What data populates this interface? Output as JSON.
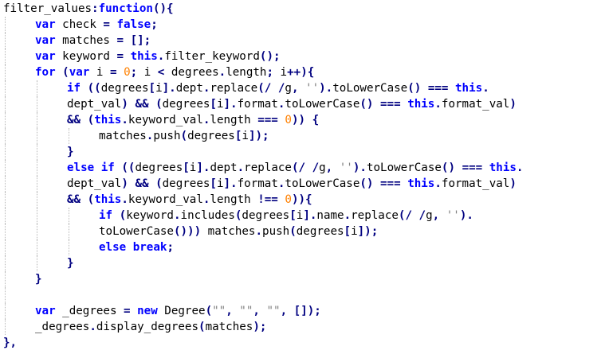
{
  "colors": {
    "background": "#ffffff",
    "plain_text": "#000000",
    "keyword": "#0000ff",
    "operator": "#000080",
    "number": "#ff8000",
    "string": "#808080",
    "indent_guide": "#b9b9b9"
  },
  "code": {
    "lines": [
      {
        "indent": 0,
        "tokens": [
          {
            "t": "plain",
            "v": "filter_values"
          },
          {
            "t": "op",
            "v": ":"
          },
          {
            "t": "kw",
            "v": "function"
          },
          {
            "t": "op",
            "v": "(){"
          }
        ]
      },
      {
        "indent": 1,
        "tokens": [
          {
            "t": "kw",
            "v": "var"
          },
          {
            "t": "plain",
            "v": " check "
          },
          {
            "t": "op",
            "v": "="
          },
          {
            "t": "plain",
            "v": " "
          },
          {
            "t": "kw",
            "v": "false"
          },
          {
            "t": "op",
            "v": ";"
          }
        ]
      },
      {
        "indent": 1,
        "tokens": [
          {
            "t": "kw",
            "v": "var"
          },
          {
            "t": "plain",
            "v": " matches "
          },
          {
            "t": "op",
            "v": "="
          },
          {
            "t": "plain",
            "v": " "
          },
          {
            "t": "op",
            "v": "[];"
          }
        ]
      },
      {
        "indent": 1,
        "tokens": [
          {
            "t": "kw",
            "v": "var"
          },
          {
            "t": "plain",
            "v": " keyword "
          },
          {
            "t": "op",
            "v": "="
          },
          {
            "t": "plain",
            "v": " "
          },
          {
            "t": "kw",
            "v": "this"
          },
          {
            "t": "op",
            "v": "."
          },
          {
            "t": "plain",
            "v": "filter_keyword"
          },
          {
            "t": "op",
            "v": "();"
          }
        ]
      },
      {
        "indent": 1,
        "tokens": [
          {
            "t": "kw",
            "v": "for"
          },
          {
            "t": "plain",
            "v": " "
          },
          {
            "t": "op",
            "v": "("
          },
          {
            "t": "kw",
            "v": "var"
          },
          {
            "t": "plain",
            "v": " i "
          },
          {
            "t": "op",
            "v": "="
          },
          {
            "t": "plain",
            "v": " "
          },
          {
            "t": "num",
            "v": "0"
          },
          {
            "t": "op",
            "v": ";"
          },
          {
            "t": "plain",
            "v": " i "
          },
          {
            "t": "op",
            "v": "<"
          },
          {
            "t": "plain",
            "v": " degrees"
          },
          {
            "t": "op",
            "v": "."
          },
          {
            "t": "plain",
            "v": "length"
          },
          {
            "t": "op",
            "v": ";"
          },
          {
            "t": "plain",
            "v": " i"
          },
          {
            "t": "op",
            "v": "++){"
          }
        ]
      },
      {
        "indent": 2,
        "tokens": [
          {
            "t": "kw",
            "v": "if"
          },
          {
            "t": "plain",
            "v": " "
          },
          {
            "t": "op",
            "v": "(("
          },
          {
            "t": "plain",
            "v": "degrees"
          },
          {
            "t": "op",
            "v": "["
          },
          {
            "t": "plain",
            "v": "i"
          },
          {
            "t": "op",
            "v": "]."
          },
          {
            "t": "plain",
            "v": "dept"
          },
          {
            "t": "op",
            "v": "."
          },
          {
            "t": "plain",
            "v": "replace"
          },
          {
            "t": "op",
            "v": "(/ /"
          },
          {
            "t": "plain",
            "v": "g"
          },
          {
            "t": "op",
            "v": ","
          },
          {
            "t": "plain",
            "v": " "
          },
          {
            "t": "str",
            "v": "''"
          },
          {
            "t": "op",
            "v": ")."
          },
          {
            "t": "plain",
            "v": "toLowerCase"
          },
          {
            "t": "op",
            "v": "()"
          },
          {
            "t": "plain",
            "v": " "
          },
          {
            "t": "op",
            "v": "==="
          },
          {
            "t": "plain",
            "v": " "
          },
          {
            "t": "kw",
            "v": "this"
          },
          {
            "t": "op",
            "v": "."
          }
        ]
      },
      {
        "indent": 2,
        "tokens": [
          {
            "t": "plain",
            "v": "dept_val"
          },
          {
            "t": "op",
            "v": ")"
          },
          {
            "t": "plain",
            "v": " "
          },
          {
            "t": "op",
            "v": "&&"
          },
          {
            "t": "plain",
            "v": " "
          },
          {
            "t": "op",
            "v": "("
          },
          {
            "t": "plain",
            "v": "degrees"
          },
          {
            "t": "op",
            "v": "["
          },
          {
            "t": "plain",
            "v": "i"
          },
          {
            "t": "op",
            "v": "]."
          },
          {
            "t": "plain",
            "v": "format"
          },
          {
            "t": "op",
            "v": "."
          },
          {
            "t": "plain",
            "v": "toLowerCase"
          },
          {
            "t": "op",
            "v": "()"
          },
          {
            "t": "plain",
            "v": " "
          },
          {
            "t": "op",
            "v": "==="
          },
          {
            "t": "plain",
            "v": " "
          },
          {
            "t": "kw",
            "v": "this"
          },
          {
            "t": "op",
            "v": "."
          },
          {
            "t": "plain",
            "v": "format_val"
          },
          {
            "t": "op",
            "v": ")"
          }
        ]
      },
      {
        "indent": 2,
        "tokens": [
          {
            "t": "op",
            "v": "&&"
          },
          {
            "t": "plain",
            "v": " "
          },
          {
            "t": "op",
            "v": "("
          },
          {
            "t": "kw",
            "v": "this"
          },
          {
            "t": "op",
            "v": "."
          },
          {
            "t": "plain",
            "v": "keyword_val"
          },
          {
            "t": "op",
            "v": "."
          },
          {
            "t": "plain",
            "v": "length "
          },
          {
            "t": "op",
            "v": "==="
          },
          {
            "t": "plain",
            "v": " "
          },
          {
            "t": "num",
            "v": "0"
          },
          {
            "t": "op",
            "v": "))"
          },
          {
            "t": "plain",
            "v": " "
          },
          {
            "t": "op",
            "v": "{"
          }
        ]
      },
      {
        "indent": 3,
        "tokens": [
          {
            "t": "plain",
            "v": "matches"
          },
          {
            "t": "op",
            "v": "."
          },
          {
            "t": "plain",
            "v": "push"
          },
          {
            "t": "op",
            "v": "("
          },
          {
            "t": "plain",
            "v": "degrees"
          },
          {
            "t": "op",
            "v": "["
          },
          {
            "t": "plain",
            "v": "i"
          },
          {
            "t": "op",
            "v": "]);"
          }
        ]
      },
      {
        "indent": 2,
        "tokens": [
          {
            "t": "op",
            "v": "}"
          }
        ]
      },
      {
        "indent": 2,
        "tokens": [
          {
            "t": "kw",
            "v": "else"
          },
          {
            "t": "plain",
            "v": " "
          },
          {
            "t": "kw",
            "v": "if"
          },
          {
            "t": "plain",
            "v": " "
          },
          {
            "t": "op",
            "v": "(("
          },
          {
            "t": "plain",
            "v": "degrees"
          },
          {
            "t": "op",
            "v": "["
          },
          {
            "t": "plain",
            "v": "i"
          },
          {
            "t": "op",
            "v": "]."
          },
          {
            "t": "plain",
            "v": "dept"
          },
          {
            "t": "op",
            "v": "."
          },
          {
            "t": "plain",
            "v": "replace"
          },
          {
            "t": "op",
            "v": "(/ /"
          },
          {
            "t": "plain",
            "v": "g"
          },
          {
            "t": "op",
            "v": ","
          },
          {
            "t": "plain",
            "v": " "
          },
          {
            "t": "str",
            "v": "''"
          },
          {
            "t": "op",
            "v": ")."
          },
          {
            "t": "plain",
            "v": "toLowerCase"
          },
          {
            "t": "op",
            "v": "()"
          },
          {
            "t": "plain",
            "v": " "
          },
          {
            "t": "op",
            "v": "==="
          },
          {
            "t": "plain",
            "v": " "
          },
          {
            "t": "kw",
            "v": "this"
          },
          {
            "t": "op",
            "v": "."
          }
        ]
      },
      {
        "indent": 2,
        "tokens": [
          {
            "t": "plain",
            "v": "dept_val"
          },
          {
            "t": "op",
            "v": ")"
          },
          {
            "t": "plain",
            "v": " "
          },
          {
            "t": "op",
            "v": "&&"
          },
          {
            "t": "plain",
            "v": " "
          },
          {
            "t": "op",
            "v": "("
          },
          {
            "t": "plain",
            "v": "degrees"
          },
          {
            "t": "op",
            "v": "["
          },
          {
            "t": "plain",
            "v": "i"
          },
          {
            "t": "op",
            "v": "]."
          },
          {
            "t": "plain",
            "v": "format"
          },
          {
            "t": "op",
            "v": "."
          },
          {
            "t": "plain",
            "v": "toLowerCase"
          },
          {
            "t": "op",
            "v": "()"
          },
          {
            "t": "plain",
            "v": " "
          },
          {
            "t": "op",
            "v": "==="
          },
          {
            "t": "plain",
            "v": " "
          },
          {
            "t": "kw",
            "v": "this"
          },
          {
            "t": "op",
            "v": "."
          },
          {
            "t": "plain",
            "v": "format_val"
          },
          {
            "t": "op",
            "v": ")"
          }
        ]
      },
      {
        "indent": 2,
        "tokens": [
          {
            "t": "op",
            "v": "&&"
          },
          {
            "t": "plain",
            "v": " "
          },
          {
            "t": "op",
            "v": "("
          },
          {
            "t": "kw",
            "v": "this"
          },
          {
            "t": "op",
            "v": "."
          },
          {
            "t": "plain",
            "v": "keyword_val"
          },
          {
            "t": "op",
            "v": "."
          },
          {
            "t": "plain",
            "v": "length "
          },
          {
            "t": "op",
            "v": "!=="
          },
          {
            "t": "plain",
            "v": " "
          },
          {
            "t": "num",
            "v": "0"
          },
          {
            "t": "op",
            "v": ")){"
          }
        ]
      },
      {
        "indent": 3,
        "tokens": [
          {
            "t": "kw",
            "v": "if"
          },
          {
            "t": "plain",
            "v": " "
          },
          {
            "t": "op",
            "v": "("
          },
          {
            "t": "plain",
            "v": "keyword"
          },
          {
            "t": "op",
            "v": "."
          },
          {
            "t": "plain",
            "v": "includes"
          },
          {
            "t": "op",
            "v": "("
          },
          {
            "t": "plain",
            "v": "degrees"
          },
          {
            "t": "op",
            "v": "["
          },
          {
            "t": "plain",
            "v": "i"
          },
          {
            "t": "op",
            "v": "]."
          },
          {
            "t": "plain",
            "v": "name"
          },
          {
            "t": "op",
            "v": "."
          },
          {
            "t": "plain",
            "v": "replace"
          },
          {
            "t": "op",
            "v": "(/ /"
          },
          {
            "t": "plain",
            "v": "g"
          },
          {
            "t": "op",
            "v": ","
          },
          {
            "t": "plain",
            "v": " "
          },
          {
            "t": "str",
            "v": "''"
          },
          {
            "t": "op",
            "v": ")."
          }
        ]
      },
      {
        "indent": 3,
        "tokens": [
          {
            "t": "plain",
            "v": "toLowerCase"
          },
          {
            "t": "op",
            "v": "()))"
          },
          {
            "t": "plain",
            "v": " matches"
          },
          {
            "t": "op",
            "v": "."
          },
          {
            "t": "plain",
            "v": "push"
          },
          {
            "t": "op",
            "v": "("
          },
          {
            "t": "plain",
            "v": "degrees"
          },
          {
            "t": "op",
            "v": "["
          },
          {
            "t": "plain",
            "v": "i"
          },
          {
            "t": "op",
            "v": "]);"
          }
        ]
      },
      {
        "indent": 3,
        "tokens": [
          {
            "t": "kw",
            "v": "else"
          },
          {
            "t": "plain",
            "v": " "
          },
          {
            "t": "kw",
            "v": "break"
          },
          {
            "t": "op",
            "v": ";"
          }
        ]
      },
      {
        "indent": 2,
        "tokens": [
          {
            "t": "op",
            "v": "}"
          }
        ]
      },
      {
        "indent": 1,
        "tokens": [
          {
            "t": "op",
            "v": "}"
          }
        ]
      },
      {
        "indent": 1,
        "tokens": []
      },
      {
        "indent": 1,
        "tokens": [
          {
            "t": "kw",
            "v": "var"
          },
          {
            "t": "plain",
            "v": " _degrees "
          },
          {
            "t": "op",
            "v": "="
          },
          {
            "t": "plain",
            "v": " "
          },
          {
            "t": "kw",
            "v": "new"
          },
          {
            "t": "plain",
            "v": " Degree"
          },
          {
            "t": "op",
            "v": "("
          },
          {
            "t": "str",
            "v": "\"\""
          },
          {
            "t": "op",
            "v": ","
          },
          {
            "t": "plain",
            "v": " "
          },
          {
            "t": "str",
            "v": "\"\""
          },
          {
            "t": "op",
            "v": ","
          },
          {
            "t": "plain",
            "v": " "
          },
          {
            "t": "str",
            "v": "\"\""
          },
          {
            "t": "op",
            "v": ","
          },
          {
            "t": "plain",
            "v": " "
          },
          {
            "t": "op",
            "v": "[]);"
          }
        ]
      },
      {
        "indent": 1,
        "tokens": [
          {
            "t": "plain",
            "v": "_degrees"
          },
          {
            "t": "op",
            "v": "."
          },
          {
            "t": "plain",
            "v": "display_degrees"
          },
          {
            "t": "op",
            "v": "("
          },
          {
            "t": "plain",
            "v": "matches"
          },
          {
            "t": "op",
            "v": ");"
          }
        ]
      },
      {
        "indent": 0,
        "tokens": [
          {
            "t": "op",
            "v": "},"
          }
        ]
      }
    ]
  }
}
